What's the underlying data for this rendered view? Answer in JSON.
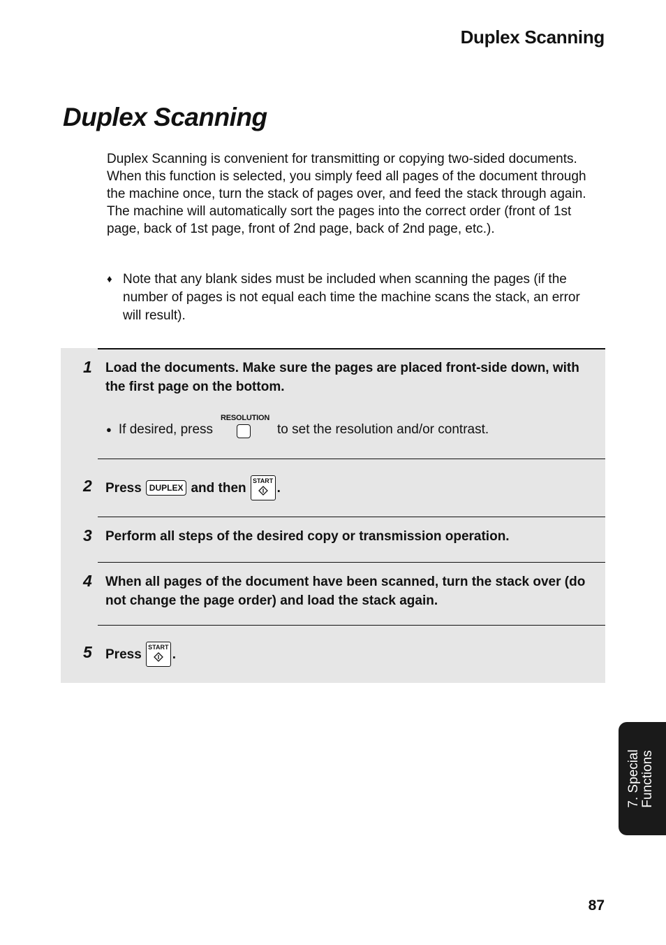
{
  "header": {
    "running_title": "Duplex Scanning"
  },
  "page_title": "Duplex Scanning",
  "intro": "Duplex Scanning is convenient for transmitting or copying two-sided documents. When this function is selected, you simply feed all pages of the document through the machine once, turn the stack of pages over, and feed the stack through again. The machine will automatically sort the pages into the correct order (front of 1st page, back of 1st page, front of 2nd page, back of 2nd page, etc.).",
  "note": {
    "bullet": "♦",
    "text": "Note that any blank sides must be included when scanning the pages (if the number of pages is not equal each time the machine scans the stack, an error will result)."
  },
  "steps": [
    {
      "number": "1",
      "text": "Load the documents. Make sure the pages are placed front-side down, with the first page on the bottom.",
      "sub_bullet": {
        "before": "If desired, press",
        "key_label": "RESOLUTION",
        "after": "to set the resolution and/or contrast."
      }
    },
    {
      "number": "2",
      "press": "Press",
      "key1": "DUPLEX",
      "and_then": "and then",
      "key2": "START",
      "end": "."
    },
    {
      "number": "3",
      "text": "Perform all steps of the desired copy or transmission operation."
    },
    {
      "number": "4",
      "text": "When all pages of the document have been scanned, turn the stack over (do not change the page order) and load the stack again."
    },
    {
      "number": "5",
      "press": "Press",
      "key": "START",
      "end": "."
    }
  ],
  "side_tab": {
    "line1": "7. Special",
    "line2": "Functions"
  },
  "page_number": "87",
  "icons": {
    "note_bullet": "diamond-bullet",
    "resolution_key": "resolution-key-icon",
    "duplex_key": "duplex-key-icon",
    "start_key": "start-key-icon"
  },
  "colors": {
    "steps_background": "#e6e6e6",
    "side_tab": "#1a1a1a"
  }
}
